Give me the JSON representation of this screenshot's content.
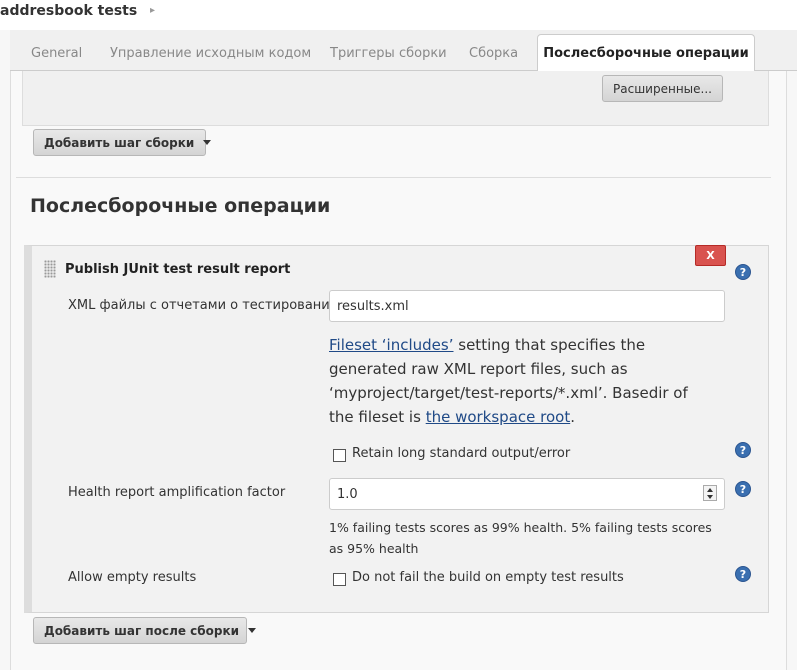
{
  "breadcrumb": {
    "title": "addresbook tests",
    "arrow": "▸"
  },
  "tabs": [
    {
      "label": "General"
    },
    {
      "label": "Управление исходным кодом"
    },
    {
      "label": "Триггеры сборки"
    },
    {
      "label": "Сборка"
    },
    {
      "label": "Послесборочные операции"
    }
  ],
  "build": {
    "advanced_button": "Расширенные...",
    "add_step_button": "Добавить шаг сборки"
  },
  "post_build": {
    "heading": "Послесборочные операции",
    "add_step_button": "Добавить шаг после сборки"
  },
  "publisher": {
    "title": "Publish JUnit test result report",
    "delete_label": "X",
    "help_glyph": "?",
    "xml_label": "XML файлы с отчетами о тестировании",
    "xml_value": "results.xml",
    "desc_link1": "Fileset ‘includes’",
    "desc_mid": " setting that specifies the generated raw XML report files, such as ‘myproject/target/test-reports/*.xml’. Basedir of the fileset is ",
    "desc_link2": "the workspace root",
    "desc_end": ".",
    "retain_label": "Retain long standard output/error",
    "health_label": "Health report amplification factor",
    "health_value": "1.0",
    "health_hint": "1% failing tests scores as 99% health. 5% failing tests scores as 95% health",
    "allow_empty_label": "Allow empty results",
    "allow_empty_checkbox": "Do not fail the build on empty test results"
  }
}
